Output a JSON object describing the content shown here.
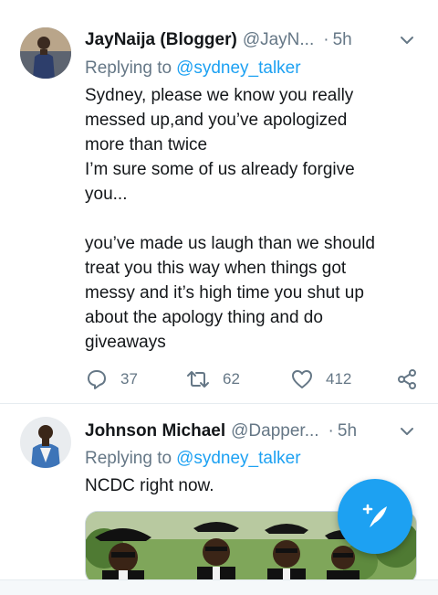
{
  "tweets": [
    {
      "name": "JayNaija (Blogger)",
      "handle": "@JayN...",
      "dot": "·",
      "time": "5h",
      "replying_label": "Replying to",
      "replying_handle": "@sydney_talker",
      "text": "Sydney, please we know you really\nmessed up,and you’ve apologized\nmore than twice\nI’m sure some of us already forgive\nyou...\n\nyou’ve made us laugh than we should\ntreat you this way when things got\nmessy and it’s high time you shut up\nabout the apology thing and do\ngiveaways",
      "reply_count": "37",
      "retweet_count": "62",
      "like_count": "412"
    },
    {
      "name": "Johnson Michael",
      "handle": "@Dapper...",
      "dot": "·",
      "time": "5h",
      "replying_label": "Replying to",
      "replying_handle": "@sydney_talker",
      "text": "NCDC right now."
    }
  ],
  "icons": {
    "reply": "reply-icon",
    "retweet": "retweet-icon",
    "like": "heart-icon",
    "share": "share-icon",
    "caret": "chevron-down-icon",
    "compose": "compose-tweet-icon"
  },
  "colors": {
    "accent": "#1da1f2",
    "secondary_text": "#657786",
    "primary_text": "#14171a",
    "divider": "#e6ecf0"
  }
}
